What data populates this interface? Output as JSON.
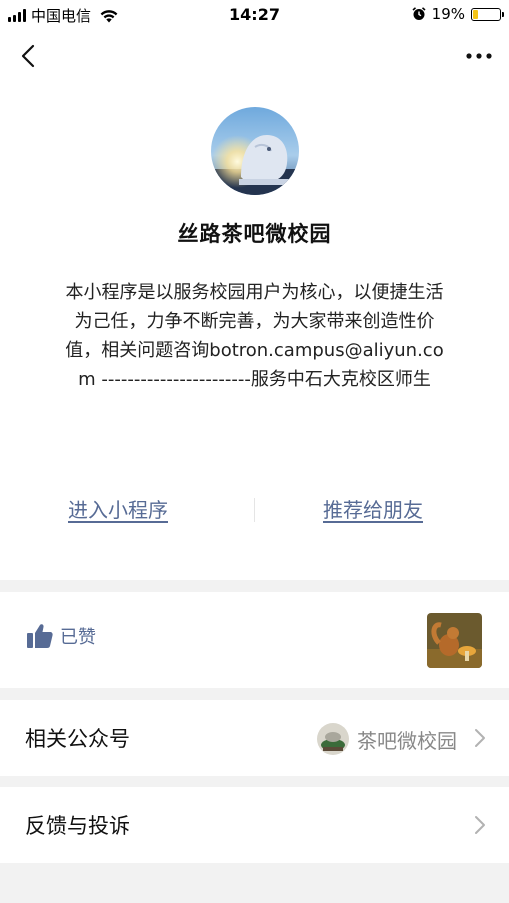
{
  "status_bar": {
    "carrier": "中国电信",
    "time": "14:27",
    "battery_percent": "19%",
    "battery_level": 0.19,
    "icons": [
      "signal-icon",
      "wifi-icon",
      "alarm-icon",
      "battery-icon"
    ]
  },
  "nav": {
    "back_icon": "chevron-left-icon",
    "more_icon": "more-dots-icon"
  },
  "profile": {
    "name": "丝路茶吧微校园",
    "description": "本小程序是以服务校园用户为核心，以便捷生活为己任，力争不断完善，为大家带来创造性价值，相关问题咨询botron.campus@aliyun.com -----------------------服务中石大克校区师生"
  },
  "actions": {
    "enter_label": "进入小程序",
    "share_label": "推荐给朋友"
  },
  "like": {
    "label": "已赞",
    "icon": "thumbs-up-icon"
  },
  "related_official": {
    "label": "相关公众号",
    "value": "茶吧微校园"
  },
  "feedback": {
    "label": "反馈与投诉"
  },
  "colors": {
    "link": "#576b95",
    "background": "#f2f2f2",
    "battery": "#f5c518"
  }
}
